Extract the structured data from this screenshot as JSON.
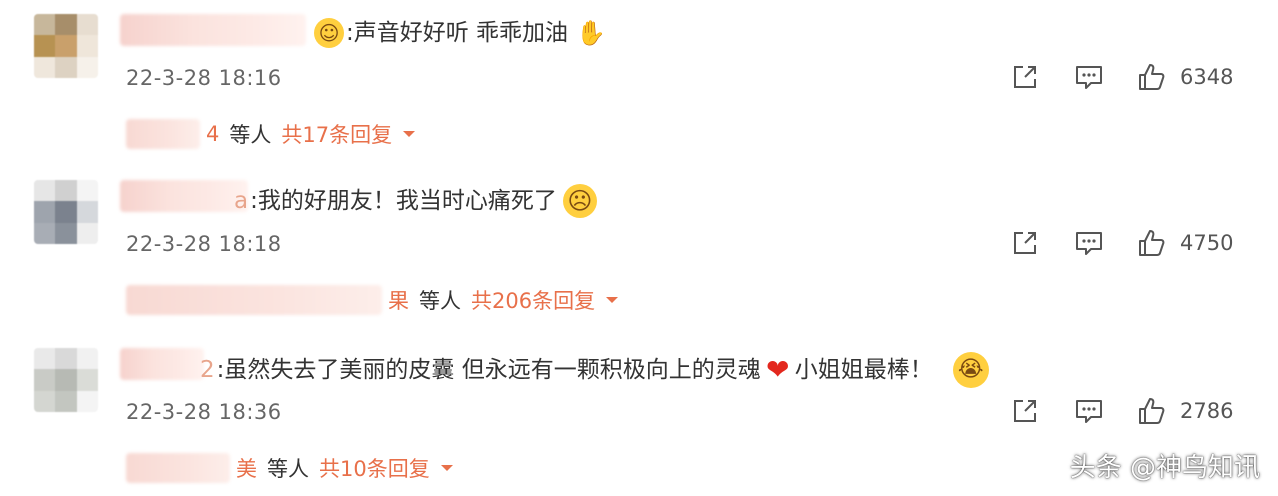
{
  "comments": [
    {
      "name_tail": "",
      "emoji_before": "☺",
      "text": ":声音好好听  乖乖加油",
      "emoji_after": "✋",
      "time": "22-3-28 18:16",
      "likes": "6348",
      "reply": {
        "name_tail": "4",
        "who": "等人",
        "total": "共17条回复"
      }
    },
    {
      "name_tail": "a",
      "emoji_before": "",
      "text": ":我的好朋友！我当时心痛死了",
      "emoji_after": "☹",
      "time": "22-3-28 18:18",
      "likes": "4750",
      "reply": {
        "name_tail": "果",
        "who": "等人",
        "total": "共206条回复"
      }
    },
    {
      "name_tail": "2",
      "emoji_before": "",
      "text": ":虽然失去了美丽的皮囊  但永远有一颗积极向上的灵魂",
      "emoji_mid": "❤",
      "text_after": "小姐姐最棒！",
      "emoji_after": "😭",
      "time": "22-3-28 18:36",
      "likes": "2786",
      "reply": {
        "name_tail": "美",
        "who": "等人",
        "total": "共10条回复"
      }
    }
  ],
  "icons": {
    "share": "share-icon",
    "comment": "comment-icon",
    "like": "thumbs-up-icon",
    "caret": "caret-down-icon"
  },
  "colors": {
    "accent": "#e8704a",
    "text": "#333333",
    "meta": "#666666"
  },
  "watermark": "头条 @神鸟知讯"
}
